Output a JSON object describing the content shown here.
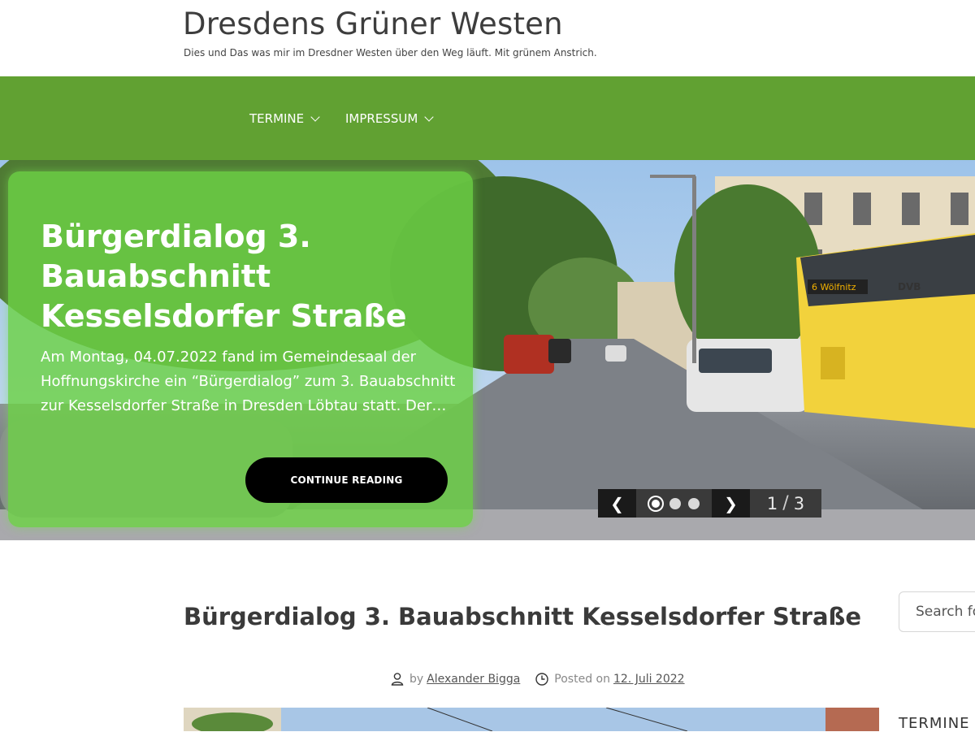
{
  "site": {
    "title": "Dresdens Grüner Westen",
    "description": "Dies und Das was mir im Dresdner Westen über den Weg läuft. Mit grünem Anstrich."
  },
  "nav": {
    "items": [
      {
        "label": "TERMINE"
      },
      {
        "label": "IMPRESSUM"
      }
    ]
  },
  "slider": {
    "title": "Bürgerdialog 3. Bauabschnitt Kesselsdorfer Straße",
    "excerpt": "Am Montag, 04.07.2022 fand im Gemeindesaal der Hoffnungskirche ein “Bürgerdialog” zum 3. Bauabschnitt zur Kesselsdorfer Straße in Dresden Löbtau statt. Der…",
    "button_label": "CONTINUE READING",
    "prev_label": "❮",
    "next_label": "❯",
    "current": "1",
    "separator": "/",
    "total": "3",
    "tram_sign": "6 Wölfnitz",
    "tram_logo": "DVB"
  },
  "post": {
    "title": "Bürgerdialog 3. Bauabschnitt Kesselsdorfer Straße",
    "by_label": "by",
    "author": "Alexander Bigga",
    "posted_label": "Posted on",
    "date": "12. Juli 2022"
  },
  "sidebar": {
    "search_placeholder": "Search fo",
    "widget_title": "TERMINE"
  },
  "colors": {
    "nav_green": "#61a132",
    "card_green": "#6cd246",
    "button_black": "#000000"
  }
}
